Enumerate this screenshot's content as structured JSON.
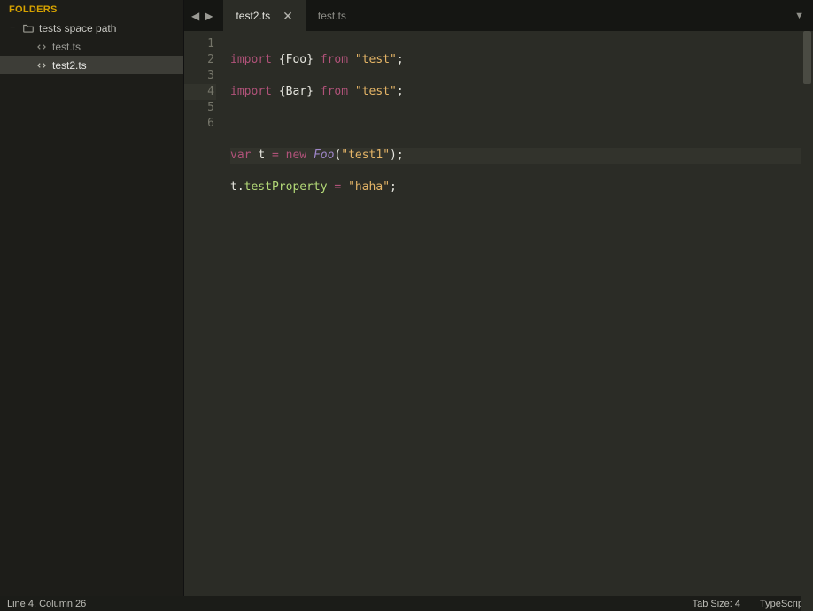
{
  "sidebar": {
    "header": "FOLDERS",
    "folder": {
      "name": "tests space path"
    },
    "files": [
      {
        "name": "test.ts"
      },
      {
        "name": "test2.ts"
      }
    ]
  },
  "tabs": [
    {
      "label": "test2.ts",
      "active": true
    },
    {
      "label": "test.ts",
      "active": false
    }
  ],
  "gutter": [
    "1",
    "2",
    "3",
    "4",
    "5",
    "6"
  ],
  "code": {
    "l1_kw1": "import",
    "l1_br1": " {",
    "l1_id": "Foo",
    "l1_br2": "} ",
    "l1_kw2": "from",
    "l1_sp": " ",
    "l1_str": "\"test\"",
    "l1_end": ";",
    "l2_kw1": "import",
    "l2_br1": " {",
    "l2_id": "Bar",
    "l2_br2": "} ",
    "l2_kw2": "from",
    "l2_sp": " ",
    "l2_str": "\"test\"",
    "l2_end": ";",
    "l4_kw": "var",
    "l4_sp1": " ",
    "l4_v": "t",
    "l4_sp2": " ",
    "l4_eq": "=",
    "l4_sp3": " ",
    "l4_new": "new",
    "l4_sp4": " ",
    "l4_cls": "Foo",
    "l4_par1": "(",
    "l4_str": "\"test1\"",
    "l4_par2": ")",
    "l4_end": ";",
    "l5_v": "t",
    "l5_dot": ".",
    "l5_prop": "testProperty",
    "l5_sp1": " ",
    "l5_eq": "=",
    "l5_sp2": " ",
    "l5_str": "\"haha\"",
    "l5_end": ";"
  },
  "status": {
    "pos": "Line 4, Column 26",
    "tabsize": "Tab Size: 4",
    "lang": "TypeScript"
  }
}
